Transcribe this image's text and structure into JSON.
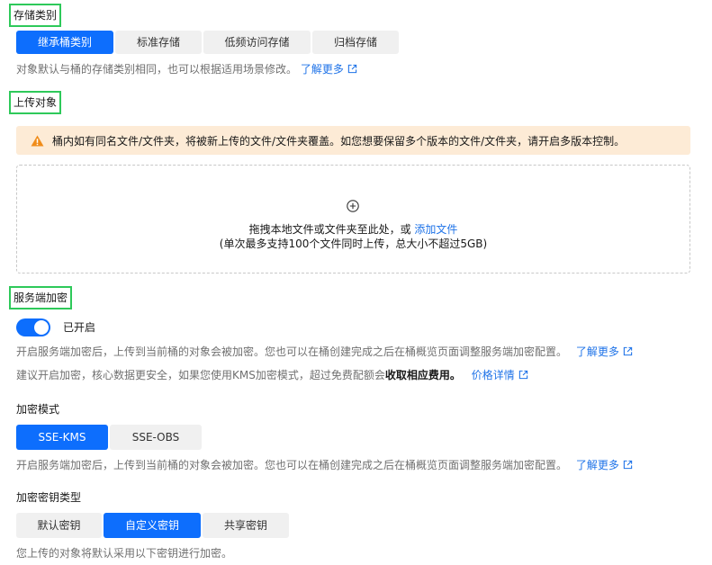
{
  "storage_class": {
    "title": "存储类别",
    "options": [
      "继承桶类别",
      "标准存储",
      "低频访问存储",
      "归档存储"
    ],
    "selected": "继承桶类别",
    "hint": "对象默认与桶的存储类别相同，也可以根据适用场景修改。",
    "learn_more": "了解更多"
  },
  "upload": {
    "title": "上传对象",
    "warning": "桶内如有同名文件/文件夹，将被新上传的文件/文件夹覆盖。如您想要保留多个版本的文件/文件夹，请开启多版本控制。",
    "drop_text": "拖拽本地文件或文件夹至此处，或",
    "add_file": "添加文件",
    "limit_text": "(单次最多支持100个文件同时上传，总大小不超过5GB)"
  },
  "encryption": {
    "title": "服务端加密",
    "toggle_state": "已开启",
    "hint1": "开启服务端加密后，上传到当前桶的对象会被加密。您也可以在桶创建完成之后在桶概览页面调整服务端加密配置。",
    "learn_more": "了解更多",
    "hint2_prefix": "建议开启加密，核心数据更安全，如果您使用KMS加密模式，超过免费配额会",
    "hint2_bold": "收取相应费用。",
    "price_link": "价格详情",
    "mode_label": "加密模式",
    "mode_options": [
      "SSE-KMS",
      "SSE-OBS"
    ],
    "mode_selected": "SSE-KMS",
    "mode_hint": "开启服务端加密后，上传到当前桶的对象会被加密。您也可以在桶创建完成之后在桶概览页面调整服务端加密配置。",
    "mode_learn_more": "了解更多",
    "key_type_label": "加密密钥类型",
    "key_type_options": [
      "默认密钥",
      "自定义密钥",
      "共享密钥"
    ],
    "key_type_selected": "自定义密钥",
    "key_hint": "您上传的对象将默认采用以下密钥进行加密。"
  },
  "colors": {
    "primary": "#0d6efd",
    "link": "#1f73e8",
    "warning_bg": "#fdebd6",
    "warning_icon": "#f08c1a",
    "highlight_border": "#2ec95a"
  }
}
